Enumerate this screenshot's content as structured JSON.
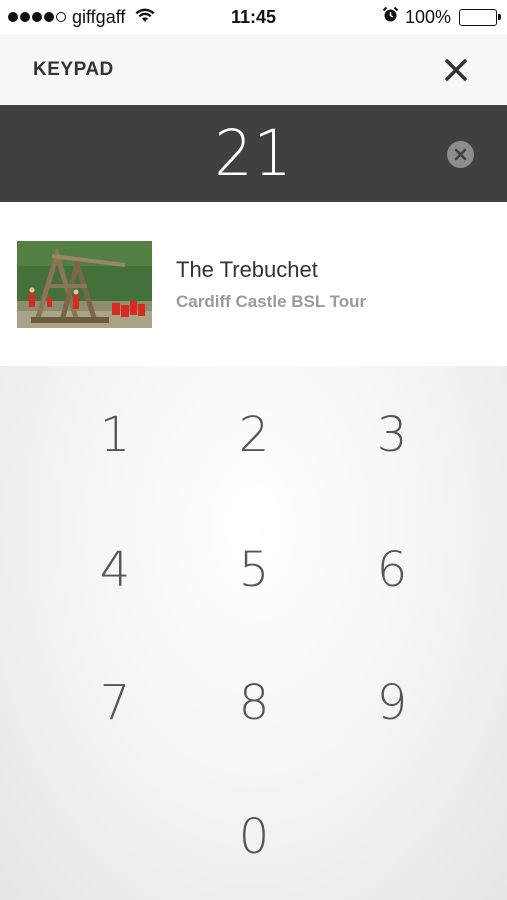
{
  "status_bar": {
    "carrier": "giffgaff",
    "time": "11:45",
    "battery_percent": "100%",
    "signal_bars_filled": 4,
    "signal_bars_total": 5
  },
  "header": {
    "title": "KEYPAD",
    "close_icon": "close-icon"
  },
  "entry": {
    "value": "21",
    "clear_icon": "clear-circle-icon"
  },
  "result": {
    "title": "The Trebuchet",
    "subtitle": "Cardiff Castle BSL Tour"
  },
  "keypad": {
    "keys": [
      "1",
      "2",
      "3",
      "4",
      "5",
      "6",
      "7",
      "8",
      "9",
      "0"
    ]
  }
}
